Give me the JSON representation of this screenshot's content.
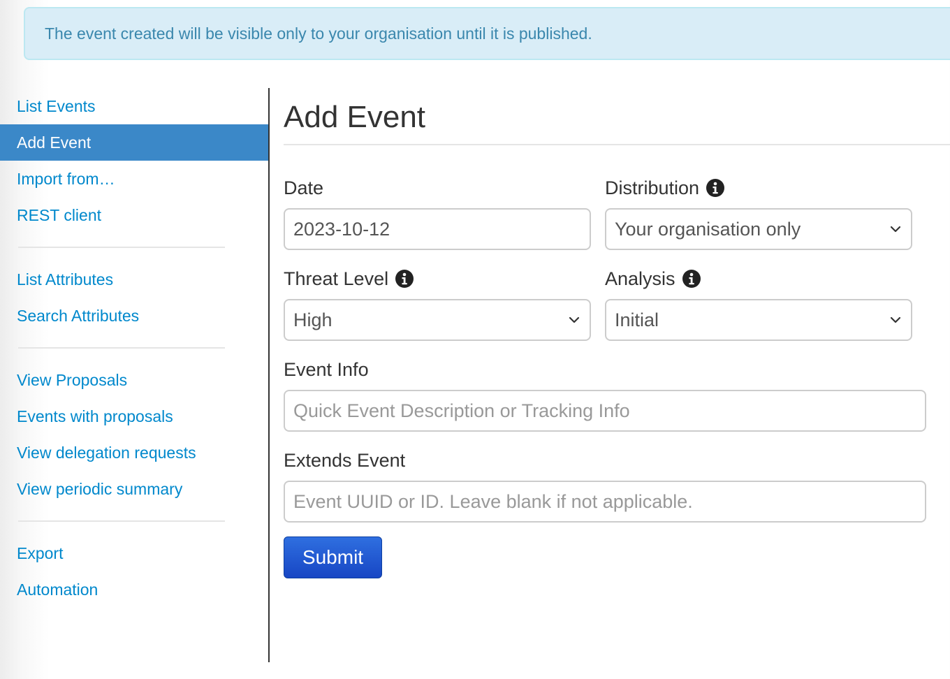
{
  "alert": {
    "text": "The event created will be visible only to your organisation until it is published."
  },
  "sidebar": {
    "groups": [
      [
        "List Events",
        "Add Event",
        "Import from…",
        "REST client"
      ],
      [
        "List Attributes",
        "Search Attributes"
      ],
      [
        "View Proposals",
        "Events with proposals",
        "View delegation requests",
        "View periodic summary"
      ],
      [
        "Export",
        "Automation"
      ]
    ],
    "active_item": "Add Event"
  },
  "main": {
    "title": "Add Event",
    "form": {
      "date": {
        "label": "Date",
        "value": "2023-10-12"
      },
      "distribution": {
        "label": "Distribution",
        "value": "Your organisation only",
        "icon": "info-icon"
      },
      "threat_level": {
        "label": "Threat Level",
        "value": "High",
        "icon": "info-icon"
      },
      "analysis": {
        "label": "Analysis",
        "value": "Initial",
        "icon": "info-icon"
      },
      "event_info": {
        "label": "Event Info",
        "placeholder": "Quick Event Description or Tracking Info",
        "value": ""
      },
      "extends_event": {
        "label": "Extends Event",
        "placeholder": "Event UUID or ID. Leave blank if not applicable.",
        "value": ""
      },
      "submit_label": "Submit"
    }
  },
  "colors": {
    "link": "#0088cc",
    "active_bg": "#3b88c8",
    "alert_bg": "#d9edf7",
    "alert_text": "#3a87ad",
    "submit_bg": "#1f55d2"
  }
}
